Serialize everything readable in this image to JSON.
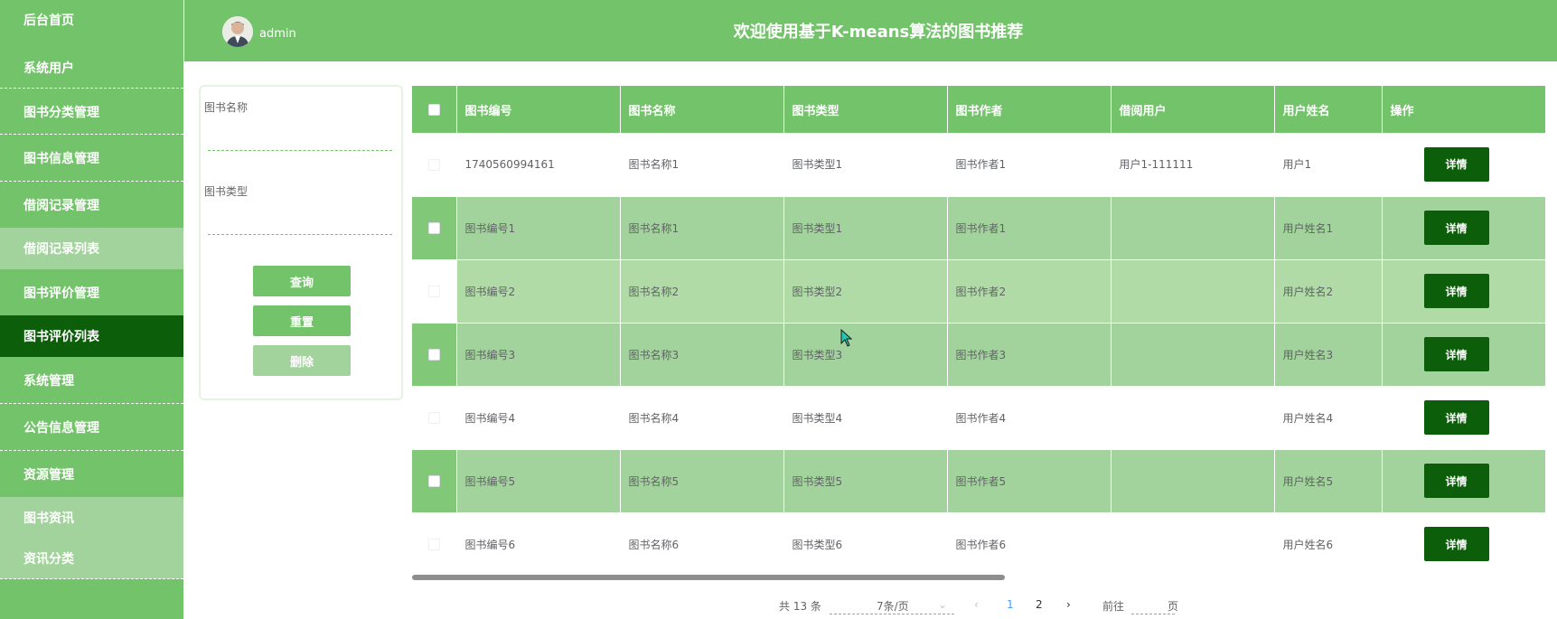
{
  "sidebar": {
    "items": [
      {
        "label": "后台首页"
      },
      {
        "label": "系统用户"
      },
      {
        "label": "图书分类管理"
      },
      {
        "label": "图书信息管理"
      },
      {
        "label": "借阅记录管理"
      },
      {
        "label": "借阅记录列表"
      },
      {
        "label": "图书评价管理"
      },
      {
        "label": "图书评价列表"
      },
      {
        "label": "系统管理"
      },
      {
        "label": "公告信息管理"
      },
      {
        "label": "资源管理"
      },
      {
        "label": "图书资讯"
      },
      {
        "label": "资讯分类"
      }
    ]
  },
  "header": {
    "username": "admin",
    "title": "欢迎使用基于K-means算法的图书推荐",
    "avatar_icon": "user-avatar-icon"
  },
  "search": {
    "field1_label": "图书名称",
    "field1_value": "",
    "field2_label": "图书类型",
    "field2_value": "",
    "search_button": "查询",
    "reset_button": "重置",
    "delete_button": "删除"
  },
  "table": {
    "columns": [
      "图书编号",
      "图书名称",
      "图书类型",
      "图书作者",
      "借阅用户",
      "用户姓名",
      "操作"
    ],
    "action_label": "详情",
    "rows": [
      [
        "1740560994161",
        "图书名称1",
        "图书类型1",
        "图书作者1",
        "用户1-111111",
        "用户1"
      ],
      [
        "图书编号1",
        "图书名称1",
        "图书类型1",
        "图书作者1",
        "",
        "用户姓名1"
      ],
      [
        "图书编号2",
        "图书名称2",
        "图书类型2",
        "图书作者2",
        "",
        "用户姓名2"
      ],
      [
        "图书编号3",
        "图书名称3",
        "图书类型3",
        "图书作者3",
        "",
        "用户姓名3"
      ],
      [
        "图书编号4",
        "图书名称4",
        "图书类型4",
        "图书作者4",
        "",
        "用户姓名4"
      ],
      [
        "图书编号5",
        "图书名称5",
        "图书类型5",
        "图书作者5",
        "",
        "用户姓名5"
      ],
      [
        "图书编号6",
        "图书名称6",
        "图书类型6",
        "图书作者6",
        "",
        "用户姓名6"
      ]
    ]
  },
  "pagination": {
    "total": "共 13 条",
    "page_size": "7条/页",
    "pages": [
      "1",
      "2"
    ],
    "current_page": "1",
    "goto_prefix": "前往",
    "goto_suffix": "页"
  },
  "colors": {
    "accent": "#72c369",
    "active": "#0c5e0a",
    "row_mid": "#a3d39c",
    "row_light": "#b0dba7"
  }
}
